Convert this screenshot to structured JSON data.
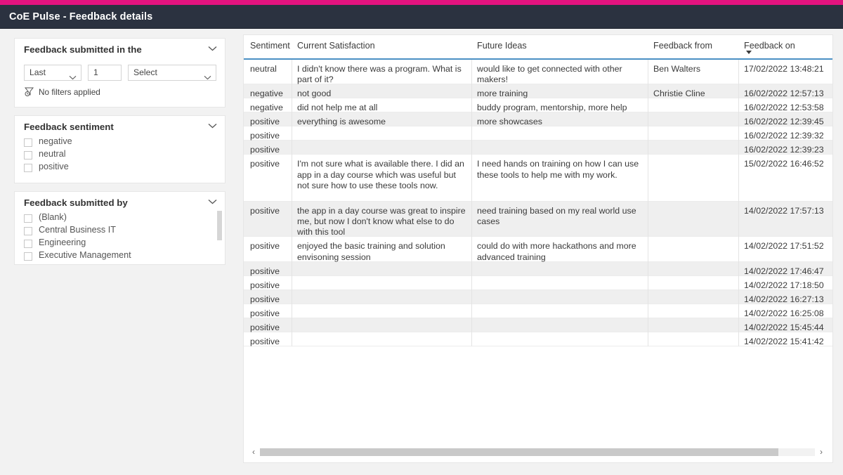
{
  "theme": {
    "accent_pink": "#e3137f",
    "header_navy": "#2b3240",
    "header_underline_blue": "#4a90c4",
    "row_alt_gray": "#efefef",
    "page_bg": "#f2f2f2"
  },
  "app": {
    "title": "CoE Pulse - Feedback details"
  },
  "filters": {
    "date_card": {
      "title": "Feedback submitted in the",
      "chevron_icon": "chevron-down-icon",
      "relation_value": "Last",
      "count_value": "1",
      "unit_placeholder": "Select",
      "status_icon": "filter-clear-icon",
      "status_text": "No filters applied"
    },
    "sentiment_card": {
      "title": "Feedback sentiment",
      "chevron_icon": "chevron-down-icon",
      "options": [
        {
          "label": "negative",
          "checked": false
        },
        {
          "label": "neutral",
          "checked": false
        },
        {
          "label": "positive",
          "checked": false
        }
      ]
    },
    "submitted_by_card": {
      "title": "Feedback submitted by",
      "chevron_icon": "chevron-down-icon",
      "options": [
        {
          "label": "(Blank)",
          "checked": false
        },
        {
          "label": "Central Business IT",
          "checked": false
        },
        {
          "label": "Engineering",
          "checked": false
        },
        {
          "label": "Executive Management",
          "checked": false
        }
      ]
    }
  },
  "table": {
    "columns": [
      {
        "key": "sentiment",
        "label": "Sentiment",
        "sorted": false
      },
      {
        "key": "current_satisfaction",
        "label": "Current Satisfaction",
        "sorted": false
      },
      {
        "key": "future_ideas",
        "label": "Future Ideas",
        "sorted": false
      },
      {
        "key": "feedback_from",
        "label": "Feedback from",
        "sorted": false
      },
      {
        "key": "feedback_on",
        "label": "Feedback on",
        "sorted": true,
        "sort_direction": "descending",
        "sort_icon": "sort-descending-icon"
      }
    ],
    "rows": [
      {
        "sentiment": "neutral",
        "current_satisfaction": "I didn't know there was a program. What is part of it?",
        "future_ideas": "would like to get connected with other makers!",
        "feedback_from": "Ben Walters",
        "feedback_on": "17/02/2022 13:48:21"
      },
      {
        "sentiment": "negative",
        "current_satisfaction": "not good",
        "future_ideas": "more training",
        "feedback_from": "Christie Cline",
        "feedback_on": "16/02/2022 12:57:13"
      },
      {
        "sentiment": "negative",
        "current_satisfaction": "did not help me at all",
        "future_ideas": "buddy program, mentorship, more help",
        "feedback_from": "",
        "feedback_on": "16/02/2022 12:53:58"
      },
      {
        "sentiment": "positive",
        "current_satisfaction": "everything is awesome",
        "future_ideas": "more showcases",
        "feedback_from": "",
        "feedback_on": "16/02/2022 12:39:45"
      },
      {
        "sentiment": "positive",
        "current_satisfaction": "",
        "future_ideas": "",
        "feedback_from": "",
        "feedback_on": "16/02/2022 12:39:32"
      },
      {
        "sentiment": "positive",
        "current_satisfaction": "",
        "future_ideas": "",
        "feedback_from": "",
        "feedback_on": "16/02/2022 12:39:23"
      },
      {
        "sentiment": "positive",
        "current_satisfaction": "I'm not sure what is available there. I did an app in a day course which was useful but not sure how to use these tools now.",
        "future_ideas": "I need hands on training on how I can use these tools to help me with my work.",
        "feedback_from": "",
        "feedback_on": "15/02/2022 16:46:52"
      },
      {
        "sentiment": "positive",
        "current_satisfaction": "the app in a day course was great to inspire me, but now I don't know what else to do with this tool",
        "future_ideas": "need training based on my real world use cases",
        "feedback_from": "",
        "feedback_on": "14/02/2022 17:57:13"
      },
      {
        "sentiment": "positive",
        "current_satisfaction": "enjoyed the basic training and solution envisoning session",
        "future_ideas": "could do with more hackathons and more advanced training",
        "feedback_from": "",
        "feedback_on": "14/02/2022 17:51:52"
      },
      {
        "sentiment": "positive",
        "current_satisfaction": "",
        "future_ideas": "",
        "feedback_from": "",
        "feedback_on": "14/02/2022 17:46:47"
      },
      {
        "sentiment": "positive",
        "current_satisfaction": "",
        "future_ideas": "",
        "feedback_from": "",
        "feedback_on": "14/02/2022 17:18:50"
      },
      {
        "sentiment": "positive",
        "current_satisfaction": "",
        "future_ideas": "",
        "feedback_from": "",
        "feedback_on": "14/02/2022 16:27:13"
      },
      {
        "sentiment": "positive",
        "current_satisfaction": "",
        "future_ideas": "",
        "feedback_from": "",
        "feedback_on": "14/02/2022 16:25:08"
      },
      {
        "sentiment": "positive",
        "current_satisfaction": "",
        "future_ideas": "",
        "feedback_from": "",
        "feedback_on": "14/02/2022 15:45:44"
      },
      {
        "sentiment": "positive",
        "current_satisfaction": "",
        "future_ideas": "",
        "feedback_from": "",
        "feedback_on": "14/02/2022 15:41:42"
      }
    ],
    "horizontal_scrollbar": {
      "left_arrow_icon": "chevron-left-icon",
      "right_arrow_icon": "chevron-right-icon"
    }
  }
}
